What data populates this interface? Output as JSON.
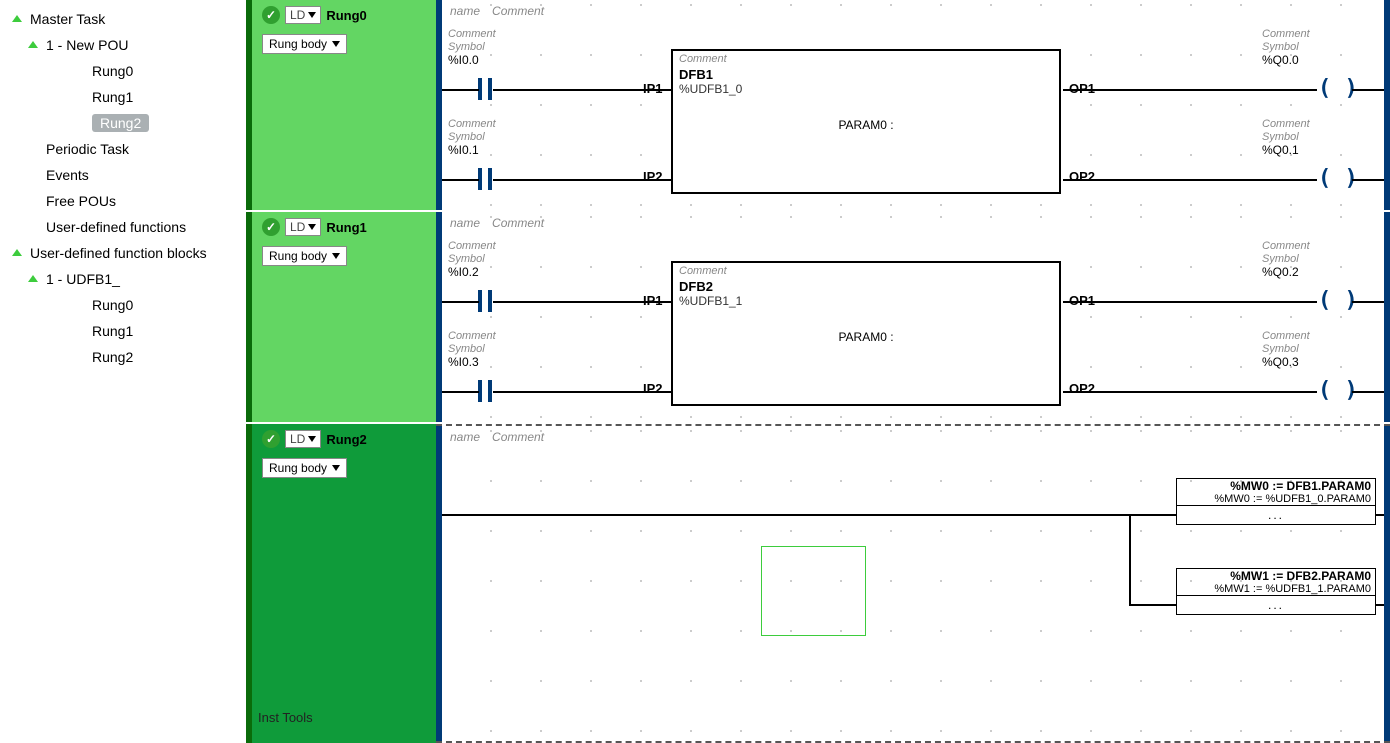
{
  "sidebar": {
    "master": "Master Task",
    "pou": "1 - New POU",
    "rungs": [
      "Rung0",
      "Rung1",
      "Rung2"
    ],
    "periodic": "Periodic Task",
    "events": "Events",
    "free": "Free POUs",
    "udf": "User-defined functions",
    "udfb": "User-defined function blocks",
    "udfb1": "1 - UDFB1_",
    "udfb_rungs": [
      "Rung0",
      "Rung1",
      "Rung2"
    ]
  },
  "common": {
    "ld": "LD",
    "rung_body": "Rung body",
    "name_ph": "name",
    "comment_ph": "Comment",
    "symbol_ph": "Symbol",
    "ip1": "IP1",
    "ip2": "IP2",
    "op1": "OP1",
    "op2": "OP2",
    "param0": "PARAM0 :"
  },
  "rung0": {
    "title": "Rung0",
    "in1": "%I0.0",
    "in2": "%I0.1",
    "out1": "%Q0.0",
    "out2": "%Q0.1",
    "fb_name": "DFB1",
    "fb_inst": "%UDFB1_0"
  },
  "rung1": {
    "title": "Rung1",
    "in1": "%I0.2",
    "in2": "%I0.3",
    "out1": "%Q0.2",
    "out2": "%Q0.3",
    "fb_name": "DFB2",
    "fb_inst": "%UDFB1_1"
  },
  "rung2": {
    "title": "Rung2",
    "op1_l1": "%MW0 := DFB1.PARAM0",
    "op1_l2": "%MW0 := %UDFB1_0.PARAM0",
    "op2_l1": "%MW1 := DFB2.PARAM0",
    "op2_l2": "%MW1 := %UDFB1_1.PARAM0",
    "dots": "..."
  },
  "watermark": "Inst Tools"
}
